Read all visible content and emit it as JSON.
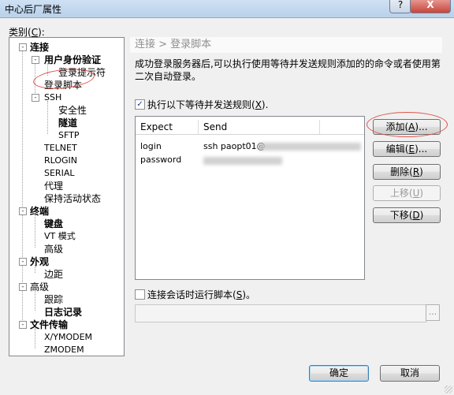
{
  "window": {
    "title": "中心后厂属性",
    "help": "?",
    "close": "X"
  },
  "category": {
    "label_prefix": "类别(",
    "label_key": "C",
    "label_suffix": "):"
  },
  "tree": [
    {
      "label": "连接",
      "bold": true
    },
    {
      "label": "用户身份验证",
      "bold": true
    },
    {
      "label": "登录提示符",
      "bold": false
    },
    {
      "label": "登录脚本",
      "bold": false
    },
    {
      "label": "SSH",
      "bold": false
    },
    {
      "label": "安全性",
      "bold": false
    },
    {
      "label": "隧道",
      "bold": true
    },
    {
      "label": "SFTP",
      "bold": false
    },
    {
      "label": "TELNET",
      "bold": false
    },
    {
      "label": "RLOGIN",
      "bold": false
    },
    {
      "label": "SERIAL",
      "bold": false
    },
    {
      "label": "代理",
      "bold": false
    },
    {
      "label": "保持活动状态",
      "bold": false
    },
    {
      "label": "终端",
      "bold": true
    },
    {
      "label": "键盘",
      "bold": true
    },
    {
      "label": "VT 模式",
      "bold": false
    },
    {
      "label": "高级",
      "bold": false
    },
    {
      "label": "外观",
      "bold": true
    },
    {
      "label": "边距",
      "bold": false
    },
    {
      "label": "高级",
      "bold": false
    },
    {
      "label": "跟踪",
      "bold": false
    },
    {
      "label": "日志记录",
      "bold": true
    },
    {
      "label": "文件传输",
      "bold": true
    },
    {
      "label": "X/YMODEM",
      "bold": false
    },
    {
      "label": "ZMODEM",
      "bold": false
    }
  ],
  "panel": {
    "header": "连接 > 登录脚本",
    "description": "成功登录服务器后,可以执行使用等待并发送规则添加的的命令或者使用第二次自动登录。",
    "expect_send_checkbox": {
      "label_prefix": "执行以下等待并发送规则(",
      "label_key": "X",
      "label_suffix": ").",
      "checked": true,
      "mark": "✓"
    },
    "table": {
      "columns": [
        "Expect",
        "Send"
      ],
      "rows": [
        {
          "expect": "login",
          "send": "ssh paopt01@"
        },
        {
          "expect": "password",
          "send": ""
        }
      ]
    },
    "buttons": {
      "add": {
        "prefix": "添加(",
        "key": "A",
        "suffix": ")..."
      },
      "edit": {
        "prefix": "编辑(",
        "key": "E",
        "suffix": ")..."
      },
      "delete": {
        "prefix": "删除(",
        "key": "R",
        "suffix": ")"
      },
      "move_up": {
        "prefix": "上移(",
        "key": "U",
        "suffix": ")"
      },
      "move_down": {
        "prefix": "下移(",
        "key": "D",
        "suffix": ")"
      }
    },
    "session_script_checkbox": {
      "label_prefix": "连接会话时运行脚本(",
      "label_key": "S",
      "label_suffix": ")。",
      "checked": false
    },
    "script_path": {
      "value": "",
      "browse": "..."
    }
  },
  "footer": {
    "ok": "确定",
    "cancel": "取消"
  },
  "annotation_color": "#e0524a"
}
